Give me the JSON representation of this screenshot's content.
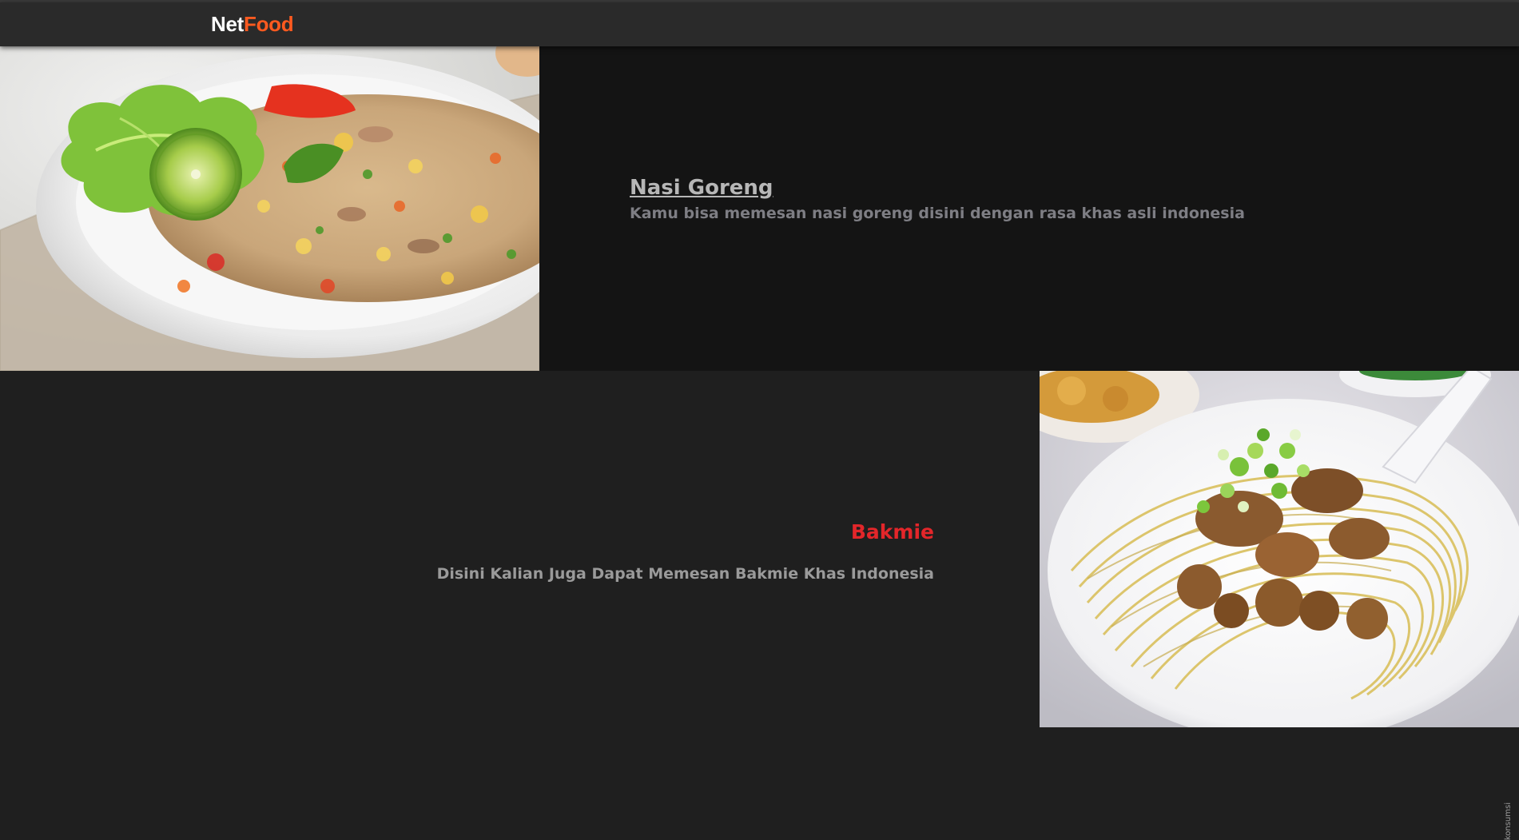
{
  "navbar": {
    "brand_part1": "Net",
    "brand_part2": "Food",
    "brand_colors": {
      "part1": "#ffffff",
      "part2": "#ff5a1f"
    }
  },
  "items": [
    {
      "title": "Nasi Goreng",
      "description": "Kamu bisa memesan nasi goreng disini dengan rasa khas asli indonesia",
      "image": "nasi-goreng-photo",
      "title_color": "#b7b7b7"
    },
    {
      "title": "Bakmie",
      "description": "Disini Kalian Juga Dapat Memesan Bakmie Khas Indonesia",
      "image": "bakmie-photo",
      "image_watermark": "konsumsi",
      "title_color": "#e3262a"
    }
  ]
}
